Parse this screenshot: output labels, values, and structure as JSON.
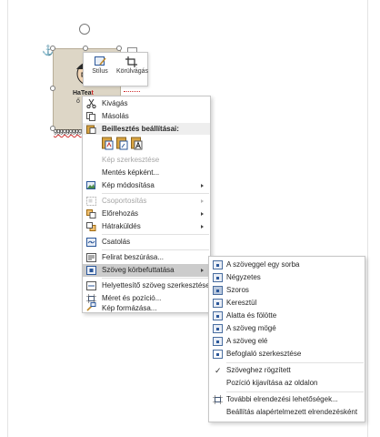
{
  "picture": {
    "name_line1": "HaTea",
    "name_line1_suffix": "t",
    "name_line2": "ő",
    "caption": "ggggggggg"
  },
  "minibar": {
    "style_label": "Stílus",
    "crop_label": "Körülvágás"
  },
  "context_menu": {
    "cut": "Kivágás",
    "copy": "Másolás",
    "paste_header": "Beillesztés beállításai:",
    "edit_picture": "Kép szerkesztése",
    "save_as_picture": "Mentés képként...",
    "change_picture": "Kép módosítása",
    "group": "Csoportosítás",
    "bring_forward": "Előrehozás",
    "send_backward": "Hátraküldés",
    "link": "Csatolás",
    "insert_caption": "Felirat beszúrása...",
    "wrap_text": "Szöveg körbefuttatása",
    "edit_alt_text": "Helyettesítő szöveg szerkesztése...",
    "size_position": "Méret és pozíció...",
    "format_picture": "Kép formázása..."
  },
  "wrap_submenu": {
    "in_line": "A szöveggel egy sorba",
    "square": "Négyzetes",
    "tight": "Szoros",
    "through": "Keresztül",
    "top_bottom": "Alatta és fölötte",
    "behind": "A szöveg mögé",
    "in_front": "A szöveg elé",
    "edit_wrap_points": "Befoglaló szerkesztése",
    "move_with_text": "Szöveghez rögzített",
    "fix_position": "Pozíció kijavítása az oldalon",
    "more_layout": "További elrendezési lehetőségek...",
    "set_default": "Beállítás alapértelmezett elrendezésként"
  },
  "colors": {
    "accent": "#2b579a",
    "highlight": "#cccccc",
    "disabled_text": "#a6a6a6"
  }
}
